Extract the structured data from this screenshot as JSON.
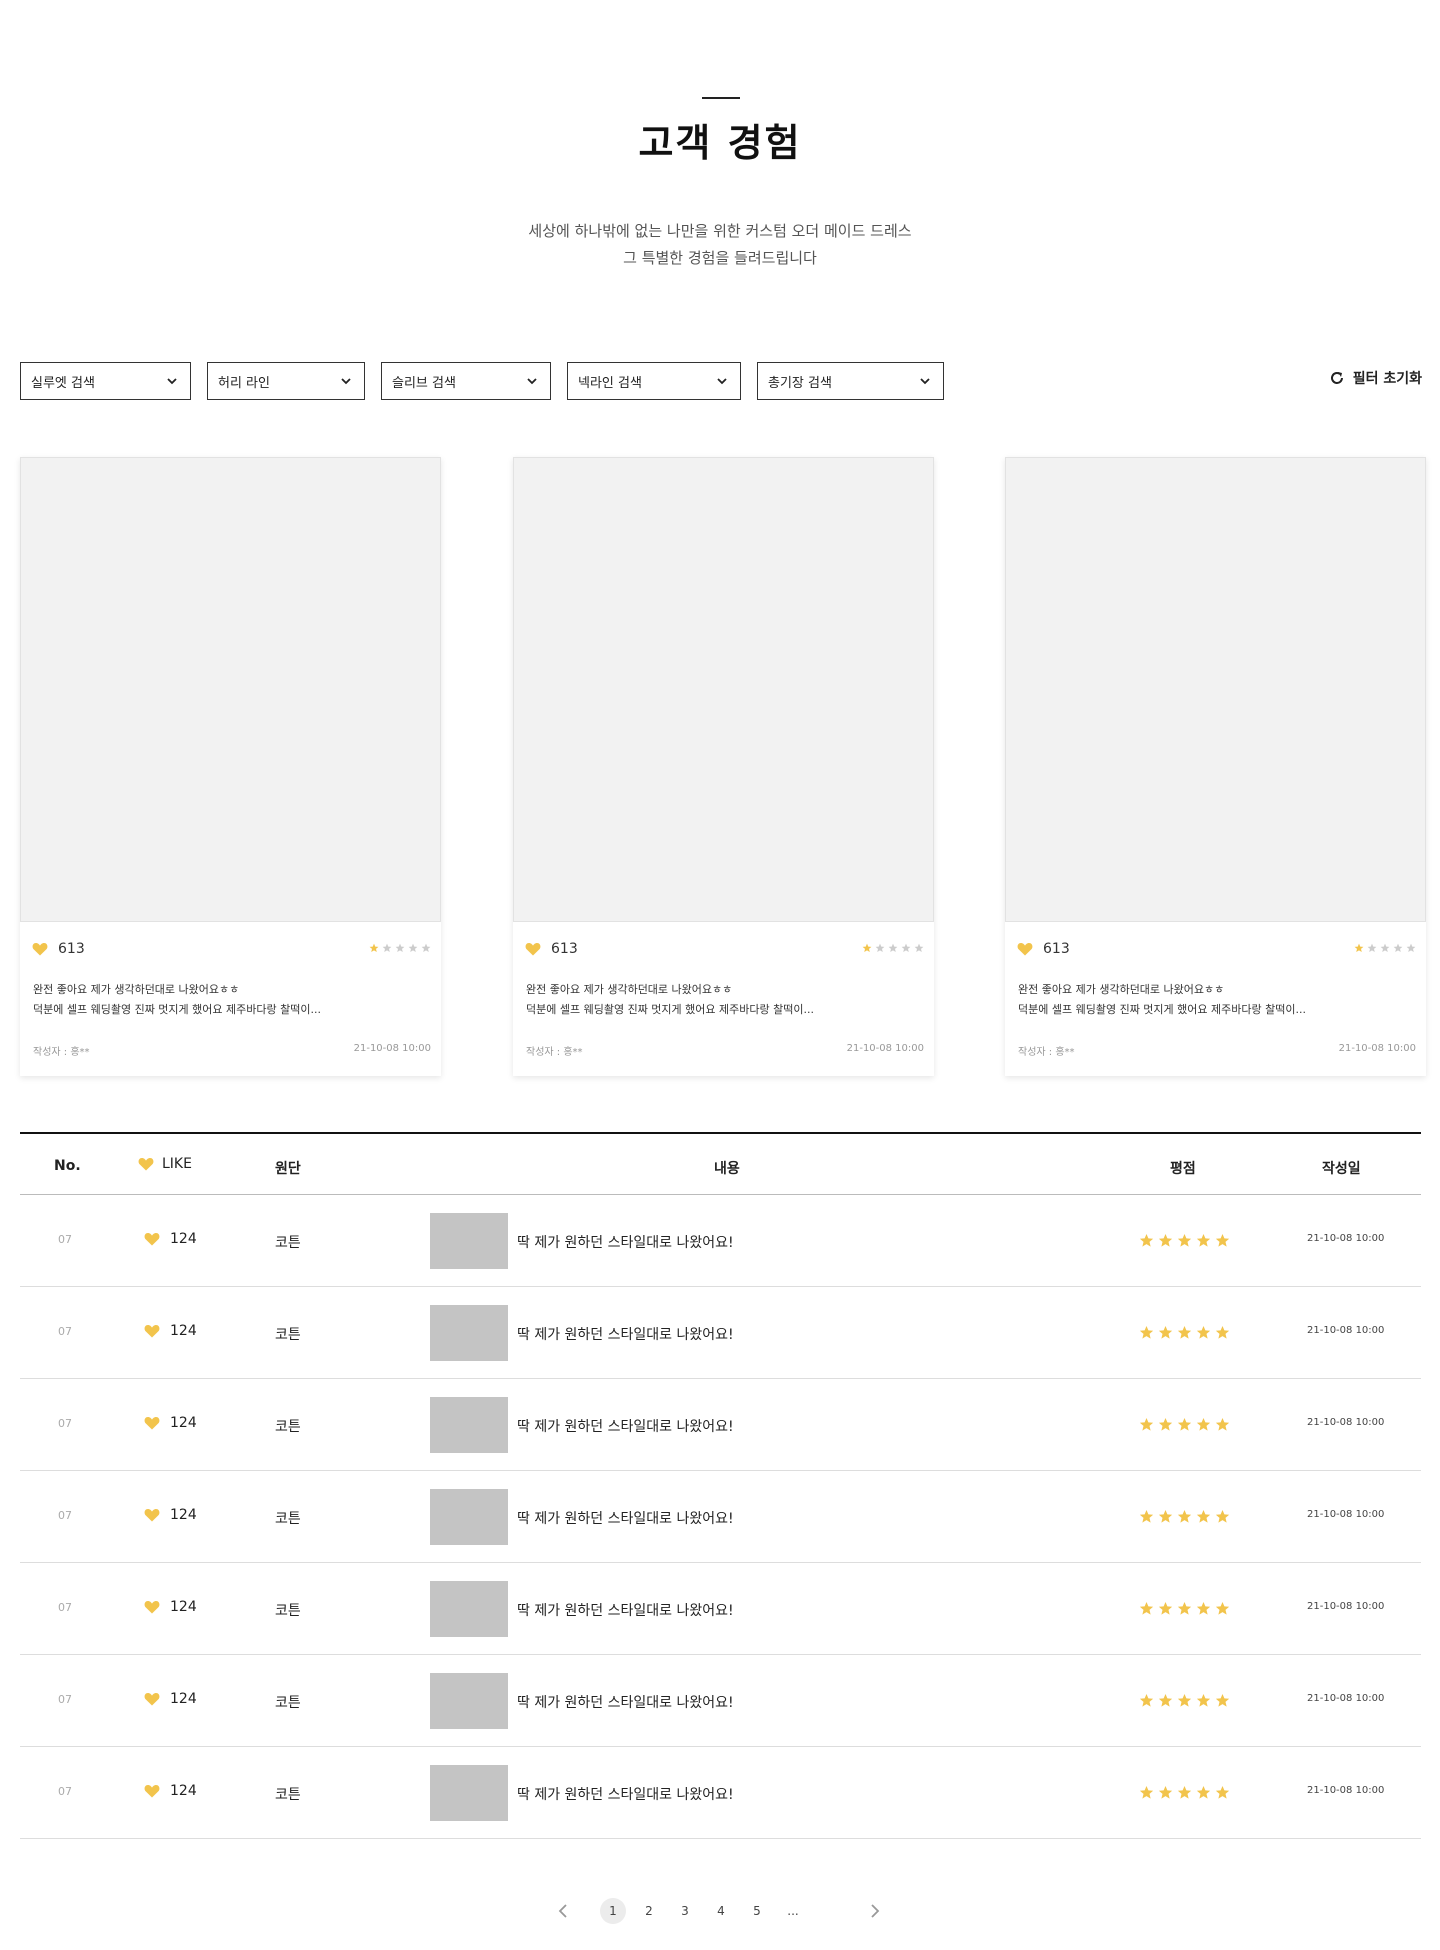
{
  "header": {
    "title": "고객 경험",
    "subtitle_line1": "세상에 하나밖에 없는 나만을 위한 커스텀 오더 메이드 드레스",
    "subtitle_line2": "그 특별한 경험을 들려드립니다"
  },
  "filters": [
    {
      "label": "실루엣 검색"
    },
    {
      "label": "허리 라인"
    },
    {
      "label": "슬리브 검색"
    },
    {
      "label": "넥라인 검색"
    },
    {
      "label": "총기장 검색"
    }
  ],
  "reset_label": "필터 초기화",
  "colors": {
    "accent": "#F2C44C",
    "star_empty": "#cccccc",
    "thumb": "#c4c4c4"
  },
  "cards": [
    {
      "likes": "613",
      "rating": 1,
      "line1": "완전 좋아요 제가 생각하던대로 나왔어요ㅎㅎ",
      "line2": "덕분에 셀프 웨딩촬영 진짜 멋지게 했어요 제주바다랑 찰떡이...",
      "author": "작성자 : 홍**",
      "date": "21-10-08 10:00"
    },
    {
      "likes": "613",
      "rating": 1,
      "line1": "완전 좋아요 제가 생각하던대로 나왔어요ㅎㅎ",
      "line2": "덕분에 셀프 웨딩촬영 진짜 멋지게 했어요 제주바다랑 찰떡이...",
      "author": "작성자 : 홍**",
      "date": "21-10-08 10:00"
    },
    {
      "likes": "613",
      "rating": 1,
      "line1": "완전 좋아요 제가 생각하던대로 나왔어요ㅎㅎ",
      "line2": "덕분에 셀프 웨딩촬영 진짜 멋지게 했어요 제주바다랑 찰떡이...",
      "author": "작성자 : 홍**",
      "date": "21-10-08 10:00"
    }
  ],
  "table": {
    "headers": {
      "no": "No.",
      "like": "LIKE",
      "fabric": "원단",
      "content": "내용",
      "rating": "평점",
      "date": "작성일"
    },
    "rows": [
      {
        "no": "07",
        "likes": "124",
        "fabric": "코튼",
        "content": "딱 제가 원하던 스타일대로 나왔어요!",
        "rating": 5,
        "date": "21-10-08 10:00"
      },
      {
        "no": "07",
        "likes": "124",
        "fabric": "코튼",
        "content": "딱 제가 원하던 스타일대로 나왔어요!",
        "rating": 5,
        "date": "21-10-08 10:00"
      },
      {
        "no": "07",
        "likes": "124",
        "fabric": "코튼",
        "content": "딱 제가 원하던 스타일대로 나왔어요!",
        "rating": 5,
        "date": "21-10-08 10:00"
      },
      {
        "no": "07",
        "likes": "124",
        "fabric": "코튼",
        "content": "딱 제가 원하던 스타일대로 나왔어요!",
        "rating": 5,
        "date": "21-10-08 10:00"
      },
      {
        "no": "07",
        "likes": "124",
        "fabric": "코튼",
        "content": "딱 제가 원하던 스타일대로 나왔어요!",
        "rating": 5,
        "date": "21-10-08 10:00"
      },
      {
        "no": "07",
        "likes": "124",
        "fabric": "코튼",
        "content": "딱 제가 원하던 스타일대로 나왔어요!",
        "rating": 5,
        "date": "21-10-08 10:00"
      },
      {
        "no": "07",
        "likes": "124",
        "fabric": "코튼",
        "content": "딱 제가 원하던 스타일대로 나왔어요!",
        "rating": 5,
        "date": "21-10-08 10:00"
      }
    ]
  },
  "pagination": {
    "pages": [
      "1",
      "2",
      "3",
      "4",
      "5",
      "..."
    ],
    "current": "1"
  }
}
